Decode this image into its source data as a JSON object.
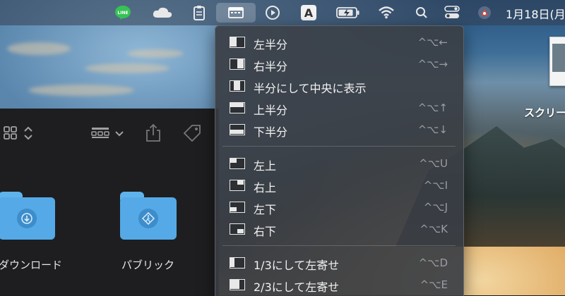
{
  "menubar": {
    "icons": [
      "line-icon",
      "cloud-icon",
      "clipboard-icon",
      "window-tiling-icon",
      "play-circle-icon",
      "input-method-icon",
      "battery-charging-icon",
      "wifi-icon",
      "search-icon",
      "control-center-icon",
      "app-icon"
    ],
    "line_label": "LINE",
    "input_label": "A",
    "clock": "1月18日(月"
  },
  "finder": {
    "folders": [
      {
        "label": "ダウンロード",
        "icon": "download-icon"
      },
      {
        "label": "パブリック",
        "icon": "pedestrian-icon"
      }
    ]
  },
  "desktop": {
    "item_label": "スクリー"
  },
  "menu": {
    "groups": [
      [
        {
          "label": "左半分",
          "shortcut": "^⌥←",
          "icon": "left-half-icon"
        },
        {
          "label": "右半分",
          "shortcut": "^⌥→",
          "icon": "right-half-icon"
        },
        {
          "label": "半分にして中央に表示",
          "shortcut": "",
          "icon": "center-half-icon"
        },
        {
          "label": "上半分",
          "shortcut": "^⌥↑",
          "icon": "top-half-icon"
        },
        {
          "label": "下半分",
          "shortcut": "^⌥↓",
          "icon": "bottom-half-icon"
        }
      ],
      [
        {
          "label": "左上",
          "shortcut": "^⌥U",
          "icon": "top-left-icon"
        },
        {
          "label": "右上",
          "shortcut": "^⌥I",
          "icon": "top-right-icon"
        },
        {
          "label": "左下",
          "shortcut": "^⌥J",
          "icon": "bottom-left-icon"
        },
        {
          "label": "右下",
          "shortcut": "^⌥K",
          "icon": "bottom-right-icon"
        }
      ],
      [
        {
          "label": "1/3にして左寄せ",
          "shortcut": "^⌥D",
          "icon": "first-third-icon"
        },
        {
          "label": "2/3にして左寄せ",
          "shortcut": "^⌥E",
          "icon": "first-two-thirds-icon"
        }
      ]
    ]
  }
}
